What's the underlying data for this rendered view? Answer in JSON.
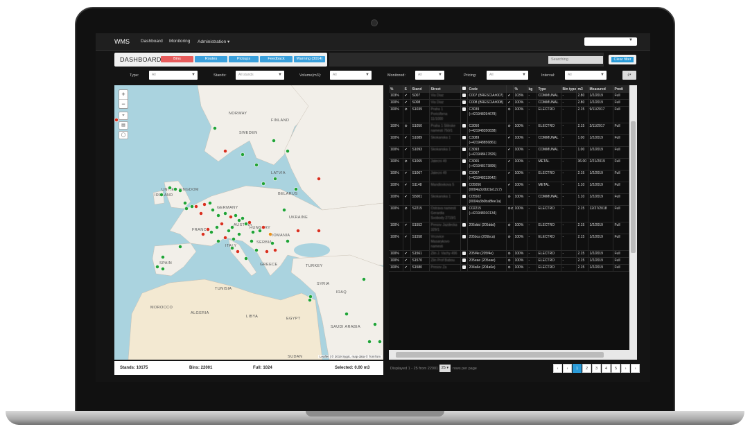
{
  "nav": {
    "brand": "WMS",
    "links": [
      "Dashboard",
      "Monitoring",
      "Administration ▾"
    ]
  },
  "dashboard": {
    "title": "DASHBOARD",
    "buttons": [
      {
        "label": "Bins",
        "color": "#e85c5c"
      },
      {
        "label": "Routes",
        "color": "#3aa0dc"
      },
      {
        "label": "Pickups",
        "color": "#3aa0dc"
      },
      {
        "label": "Feedback",
        "color": "#3aa0dc"
      },
      {
        "label": "Warning (3014)",
        "color": "#3aa0dc"
      }
    ],
    "search_placeholder": "Searching",
    "clear_filter": "Clear filter"
  },
  "filters": [
    {
      "label": "Type:",
      "value": "All"
    },
    {
      "label": "Stands:",
      "value": "All stands"
    },
    {
      "label": "Volume(m3):",
      "value": "All"
    },
    {
      "label": "Monitored:",
      "value": "All"
    },
    {
      "label": "Pricing:",
      "value": "All"
    },
    {
      "label": "Interval:",
      "value": "All"
    }
  ],
  "map": {
    "countries": [
      "NORWAY",
      "SWEDEN",
      "FINLAND",
      "LATVIA",
      "BELARUS",
      "UNITED KINGDOM",
      "IRELAND",
      "FRANCE",
      "GERMANY",
      "AUSTRIA",
      "HUNGARY",
      "UKRAINE",
      "ROMANIA",
      "SERBIA",
      "ITALY",
      "GREECE",
      "TURKEY",
      "SPAIN",
      "TUNISIA",
      "SYRIA",
      "IRAQ",
      "MOROCCO",
      "ALGERIA",
      "LIBYA",
      "EGYPT",
      "SAUDI ARABIA",
      "SUDAN"
    ],
    "attribution": "Leaflet | © 2019 Sygic, map data © TomTom",
    "footer": {
      "stands": "Stands: 10175",
      "bins": "Bins: 22001",
      "full": "Full: 1024",
      "selected": "Selected: 0.00 m3"
    }
  },
  "table": {
    "columns": [
      "%",
      "S",
      "Stand",
      "Street",
      "",
      "Code",
      "",
      "%",
      "kg",
      "Type",
      "Bin type",
      "m3",
      "Measured",
      "Predi"
    ],
    "rows": [
      [
        "103%",
        "✔",
        "S007",
        "Via Diaz",
        "",
        "C007 (BRESCIA#007)",
        "✔",
        "103%",
        "-",
        "COMMUNAL",
        "-",
        "2.80",
        "1/2/2019",
        "Full"
      ],
      [
        "100%",
        "✔",
        "S008",
        "Via Diaz",
        "",
        "C008 (BRESCIA#008)",
        "✔",
        "100%",
        "-",
        "COMMUNAL",
        "-",
        "2.80",
        "1/2/2019",
        "Full"
      ],
      [
        "100%",
        "⊘",
        "S1039",
        "Praha 1 Porici/brna 11/1000",
        "",
        "C3039 (+421948294678)",
        "⊘",
        "100%",
        "-",
        "ELECTRO",
        "-",
        "2.15",
        "9/11/2017",
        "Full"
      ],
      [
        "100%",
        "⊘",
        "S1050",
        "Praha 1 Stitrske namesti 750/1",
        "",
        "C3050 (+421948350838)",
        "⊘",
        "100%",
        "-",
        "ELECTRO",
        "-",
        "2.15",
        "2/11/2017",
        "Full"
      ],
      [
        "100%",
        "✔",
        "S1089",
        "Skokanska 1",
        "",
        "C3089 (+421948856861)",
        "✔",
        "100%",
        "-",
        "COMMUNAL",
        "-",
        "1.00",
        "1/2/2019",
        "Full"
      ],
      [
        "100%",
        "✔",
        "S1093",
        "Skokanska 1",
        "",
        "C3093 (+421948417826)",
        "✔",
        "100%",
        "-",
        "COMMUNAL",
        "-",
        "1.00",
        "1/2/2019",
        "Full"
      ],
      [
        "100%",
        "⊘",
        "S1065",
        "Jatecni 49",
        "",
        "C3065 (+421948173895)",
        "✔",
        "100%",
        "-",
        "METAL",
        "-",
        "36.00",
        "2/21/2019",
        "Full"
      ],
      [
        "100%",
        "✔",
        "S1067",
        "Jatecni 49",
        "",
        "C3067 (+421948232642)",
        "✔",
        "100%",
        "-",
        "ELECTRO",
        "-",
        "2.15",
        "1/2/2019",
        "Full"
      ],
      [
        "100%",
        "✔",
        "S1148",
        "Mandlovkova 5",
        "",
        "C05056 (0004a3c0b01e12c7)",
        "✔",
        "100%",
        "-",
        "METAL",
        "-",
        "1.10",
        "1/2/2019",
        "Full"
      ],
      [
        "100%",
        "✔",
        "S5001",
        "Skokanska 1",
        "",
        "C05502 (0004a3b0ba8fee1a)",
        "⊘",
        "100%",
        "-",
        "COMMUNAL",
        "-",
        "1.10",
        "1/2/2019",
        "Full"
      ],
      [
        "100%",
        "⊘",
        "S2215",
        "Ostrava namesti Gerardia Svobody 2719/1",
        "",
        "C02215 (+421948010134)",
        "⊘⊘",
        "100%",
        "-",
        "ELECTRO",
        "-",
        "2.15",
        "12/27/2018",
        "Full"
      ],
      [
        "100%",
        "✔",
        "S1552",
        "Presov Jazdecka 329/1",
        "",
        "205ddd (205ddd)",
        "⊘",
        "100%",
        "-",
        "ELECTRO",
        "-",
        "2.15",
        "1/2/2019",
        "Full"
      ],
      [
        "100%",
        "✔",
        "S1558",
        "Vrcovice Masarykovo namesti",
        "",
        "205bca (205bca)",
        "⊘",
        "100%",
        "-",
        "ELECTRO",
        "-",
        "2.15",
        "1/2/2019",
        "Full"
      ],
      [
        "100%",
        "✔",
        "S1561",
        "Zlin J. Vachy 496",
        "",
        "205f4e (205f4e)",
        "⊘",
        "100%",
        "-",
        "ELECTRO",
        "-",
        "2.15",
        "1/2/2019",
        "Full"
      ],
      [
        "100%",
        "✔",
        "S1570",
        "Zlin Prof Babou",
        "",
        "205eae (205eae)",
        "⊘",
        "100%",
        "-",
        "ELECTRO",
        "-",
        "2.15",
        "1/2/2019",
        "Full"
      ],
      [
        "100%",
        "✔",
        "S1580",
        "Presov Za",
        "",
        "204a6e (204a6e)",
        "⊘",
        "100%",
        "-",
        "ELECTRO",
        "-",
        "2.15",
        "1/2/2019",
        "Full"
      ]
    ]
  },
  "pager": {
    "displayed": "Displayed 1 - 25 from 22001",
    "per_page_value": "25 ▾",
    "per_page_label": "rows per page",
    "pages": [
      "‹",
      "‹",
      "1",
      "2",
      "3",
      "4",
      "5",
      "›",
      "›"
    ],
    "active_page": "1"
  },
  "colors": {
    "green_dot": "#21a336",
    "red_dot": "#d9301f",
    "orange_dot": "#e8901f",
    "accent": "#2a9bd8"
  }
}
